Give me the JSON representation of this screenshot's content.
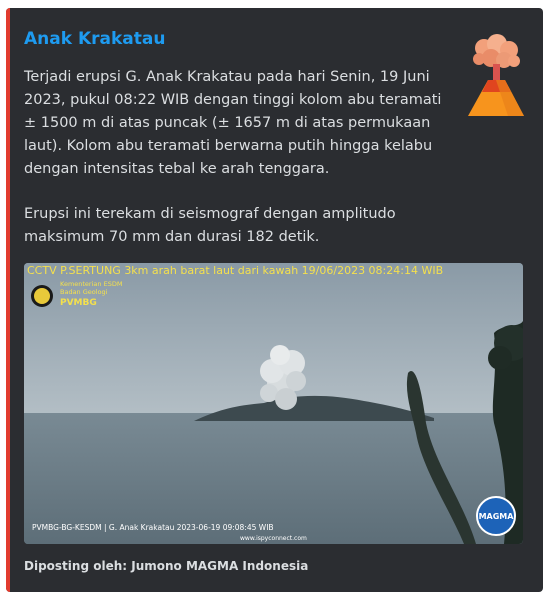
{
  "embed": {
    "title": "Anak Krakatau",
    "accent_color": "#e23b2e",
    "title_color": "#1e9bf0",
    "thumbnail_icon": "volcano-icon",
    "description_paragraphs": [
      "Terjadi erupsi G. Anak Krakatau pada hari Senin, 19 Juni 2023, pukul 08:22 WIB dengan tinggi kolom abu teramati ± 1500 m di atas puncak (± 1657 m di atas permukaan laut). Kolom abu teramati berwarna putih hingga kelabu dengan intensitas tebal ke arah tenggara.",
      "Erupsi ini terekam di seismograf dengan amplitudo maksimum 70 mm dan durasi 182 detik."
    ],
    "image": {
      "overlay_top": "CCTV P.SERTUNG 3km arah barat laut dari kawah 19/06/2023 08:24:14 WIB",
      "badge_line1": "Kementerian ESDM",
      "badge_line2": "Badan Geologi",
      "badge_line3": "PVMBG",
      "overlay_bottom": "PVMBG-BG-KESDM | G. Anak Krakatau 2023-06-19 09:08:45 WIB",
      "overlay_url": "www.ispyconnect.com",
      "corner_logo": "MAGMA"
    },
    "footer": "Diposting oleh: Jumono MAGMA Indonesia"
  }
}
